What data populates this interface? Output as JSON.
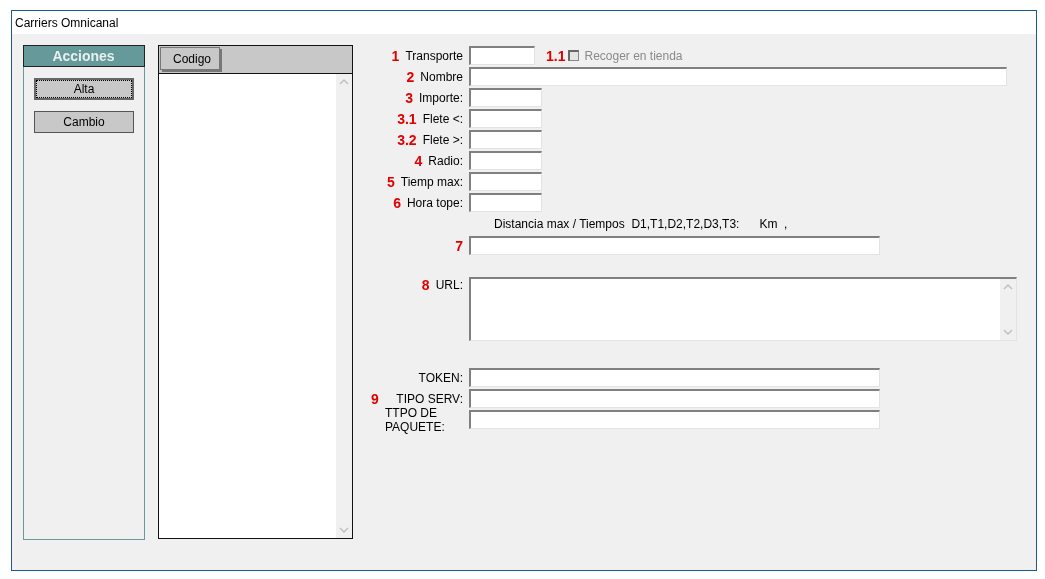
{
  "window": {
    "title": "Carriers Omnicanal"
  },
  "actions": {
    "title": "Acciones",
    "buttons": [
      {
        "label": "Alta",
        "focused": true
      },
      {
        "label": "Cambio",
        "focused": false
      }
    ]
  },
  "list": {
    "columns": [
      {
        "label": "Codigo"
      }
    ]
  },
  "form": {
    "rows": [
      {
        "kind": "short",
        "number": "1",
        "label": "Transporte",
        "checkbox": {
          "number": "1.1",
          "label": "Recoger en tienda",
          "checked": false,
          "disabled": true
        }
      },
      {
        "kind": "wide",
        "number": "2",
        "label": "Nombre"
      },
      {
        "kind": "medium",
        "number": "3",
        "label": "Importe:"
      },
      {
        "kind": "medium",
        "number": "3.1",
        "label": "Flete <:"
      },
      {
        "kind": "medium",
        "number": "3.2",
        "label": "Flete >:"
      },
      {
        "kind": "medium",
        "number": "4",
        "label": "Radio:"
      },
      {
        "kind": "medium",
        "number": "5",
        "label": "Tiemp max:"
      },
      {
        "kind": "medium",
        "number": "6",
        "label": "Hora tope:"
      },
      {
        "kind": "note",
        "text": "Distancia max / Tiempos  D1,T1,D2,T2,D3,T3:      Km  ,"
      },
      {
        "kind": "long",
        "number": "7"
      },
      {
        "kind": "textarea",
        "number": "8",
        "label": "URL:"
      },
      {
        "kind": "group",
        "number": "9",
        "rows": [
          {
            "kind": "long",
            "label": "TOKEN:"
          },
          {
            "kind": "long",
            "label": "TIPO SERV:"
          },
          {
            "kind": "long",
            "label": "TTPO DE PAQUETE:"
          }
        ]
      }
    ]
  }
}
